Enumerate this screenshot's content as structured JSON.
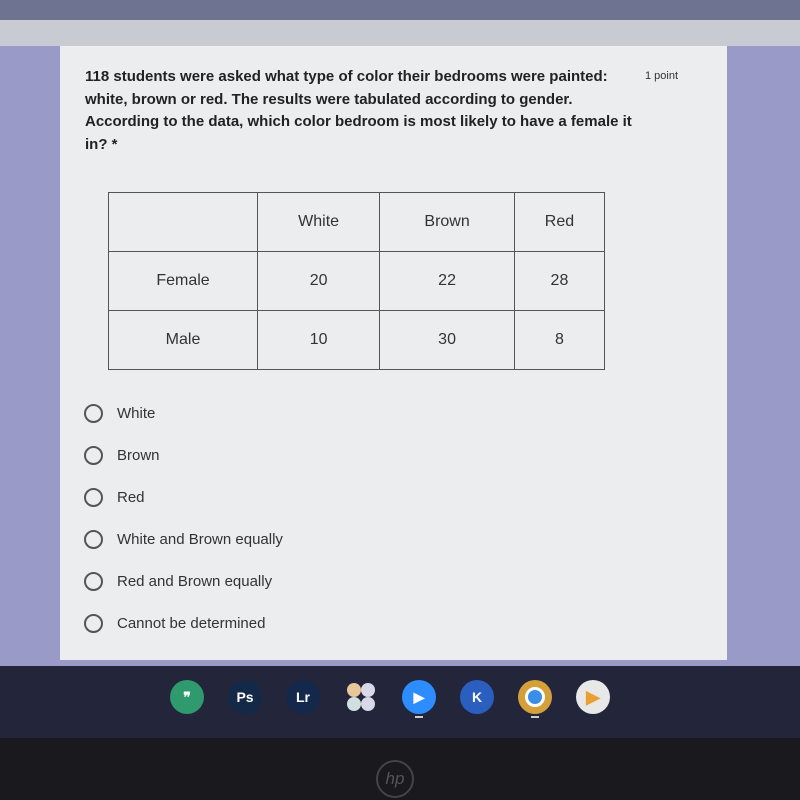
{
  "question": {
    "text": "118 students were asked what type of color their bedrooms were painted: white, brown or red. The results were tabulated according to gender. According to the data, which color bedroom is most likely to have a female it in? *",
    "points": "1 point"
  },
  "table": {
    "headers": [
      "",
      "White",
      "Brown",
      "Red"
    ],
    "rows": [
      [
        "Female",
        "20",
        "22",
        "28"
      ],
      [
        "Male",
        "10",
        "30",
        "8"
      ]
    ]
  },
  "options": [
    "White",
    "Brown",
    "Red",
    "White and Brown equally",
    "Red and Brown equally",
    "Cannot be determined"
  ],
  "taskbar": [
    {
      "icon": "hangouts-icon",
      "label": "",
      "color": "#2e9a6e"
    },
    {
      "icon": "photoshop-express-icon",
      "label": "Ps",
      "color": "#142848"
    },
    {
      "icon": "lightroom-icon",
      "label": "Lr",
      "color": "#13284a"
    },
    {
      "icon": "app-launcher-icon",
      "label": "",
      "color": "transparent"
    },
    {
      "icon": "zoom-icon",
      "label": "",
      "color": "#2d8cff"
    },
    {
      "icon": "kahoot-icon",
      "label": "K",
      "color": "#2a5fc0"
    },
    {
      "icon": "chrome-icon",
      "label": "",
      "color": "#d4a03a"
    },
    {
      "icon": "play-store-icon",
      "label": "",
      "color": "#e8e8e8"
    }
  ],
  "bezel_logo": "hp"
}
